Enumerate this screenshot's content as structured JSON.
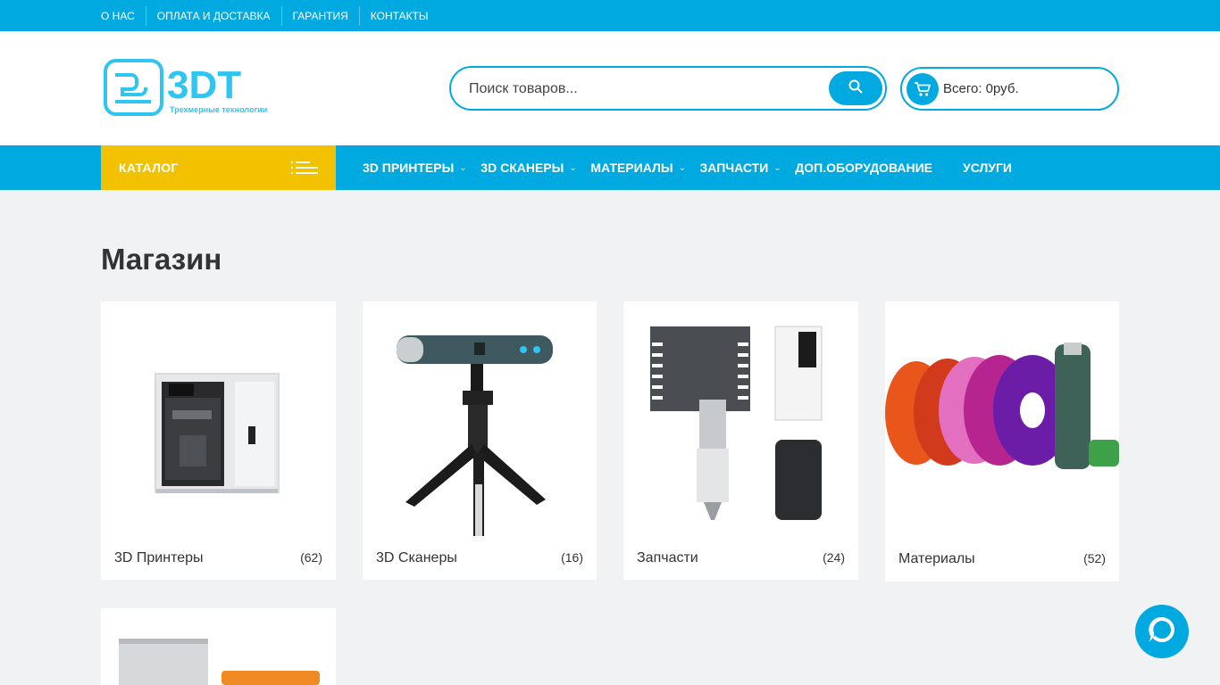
{
  "topbar": {
    "links": [
      "О НАС",
      "ОПЛАТА И ДОСТАВКА",
      "ГАРАНТИЯ",
      "КОНТАКТЫ"
    ]
  },
  "header": {
    "logo_text": "3DT",
    "logo_tagline": "Трехмерные технологии",
    "search_placeholder": "Поиск товаров...",
    "cart_total": "Всего: 0руб."
  },
  "nav": {
    "catalog_label": "КАТАЛОГ",
    "items": [
      {
        "label": "3D ПРИНТЕРЫ"
      },
      {
        "label": "3D СКАНЕРЫ"
      },
      {
        "label": "МАТЕРИАЛЫ"
      },
      {
        "label": "ЗАПЧАСТИ"
      },
      {
        "label": "ДОП.ОБОРУДОВАНИЕ"
      },
      {
        "label": "УСЛУГИ"
      }
    ]
  },
  "main": {
    "title": "Магазин",
    "categories": [
      {
        "name": "3D Принтеры",
        "count": "(62)"
      },
      {
        "name": "3D Сканеры",
        "count": "(16)"
      },
      {
        "name": "Запчасти",
        "count": "(24)"
      },
      {
        "name": "Материалы",
        "count": "(52)"
      }
    ]
  },
  "colors": {
    "accent": "#00a9e0",
    "catalog": "#f2c200",
    "background": "#f1f2f4"
  },
  "icons": [
    "search-icon",
    "cart-icon",
    "menu-lines-icon",
    "chevron-down-icon",
    "chat-icon"
  ]
}
